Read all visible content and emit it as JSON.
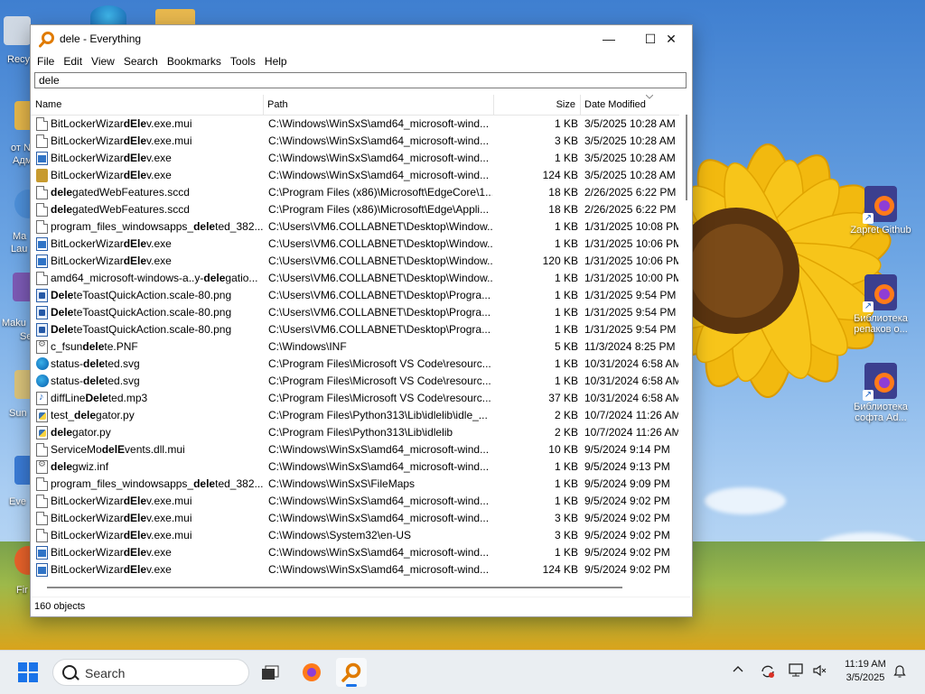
{
  "window": {
    "title": "dele - Everything",
    "minimize": "—",
    "maximize": "☐",
    "close": "✕"
  },
  "menu": [
    "File",
    "Edit",
    "View",
    "Search",
    "Bookmarks",
    "Tools",
    "Help"
  ],
  "search": {
    "value": "dele"
  },
  "columns": {
    "name": "Name",
    "path": "Path",
    "size": "Size",
    "date": "Date Modified"
  },
  "rows": [
    {
      "icon": "doc",
      "name": "BitLockerWizardElev.exe.mui",
      "path": "C:\\Windows\\WinSxS\\amd64_microsoft-wind...",
      "size": "1 KB",
      "date": "3/5/2025 10:28 AM"
    },
    {
      "icon": "doc",
      "name": "BitLockerWizardElev.exe.mui",
      "path": "C:\\Windows\\WinSxS\\amd64_microsoft-wind...",
      "size": "3 KB",
      "date": "3/5/2025 10:28 AM"
    },
    {
      "icon": "exe",
      "name": "BitLockerWizardElev.exe",
      "path": "C:\\Windows\\WinSxS\\amd64_microsoft-wind...",
      "size": "1 KB",
      "date": "3/5/2025 10:28 AM"
    },
    {
      "icon": "setup",
      "name": "BitLockerWizardElev.exe",
      "path": "C:\\Windows\\WinSxS\\amd64_microsoft-wind...",
      "size": "124 KB",
      "date": "3/5/2025 10:28 AM"
    },
    {
      "icon": "doc",
      "name": "delegatedWebFeatures.sccd",
      "path": "C:\\Program Files (x86)\\Microsoft\\EdgeCore\\1...",
      "size": "18 KB",
      "date": "2/26/2025 6:22 PM"
    },
    {
      "icon": "doc",
      "name": "delegatedWebFeatures.sccd",
      "path": "C:\\Program Files (x86)\\Microsoft\\Edge\\Appli...",
      "size": "18 KB",
      "date": "2/26/2025 6:22 PM"
    },
    {
      "icon": "doc",
      "name": "program_files_windowsapps_deleted_382...",
      "path": "C:\\Users\\VM6.COLLABNET\\Desktop\\Window...",
      "size": "1 KB",
      "date": "1/31/2025 10:08 PM"
    },
    {
      "icon": "exe",
      "name": "BitLockerWizardElev.exe",
      "path": "C:\\Users\\VM6.COLLABNET\\Desktop\\Window...",
      "size": "1 KB",
      "date": "1/31/2025 10:06 PM"
    },
    {
      "icon": "exe",
      "name": "BitLockerWizardElev.exe",
      "path": "C:\\Users\\VM6.COLLABNET\\Desktop\\Window...",
      "size": "120 KB",
      "date": "1/31/2025 10:06 PM"
    },
    {
      "icon": "doc",
      "name": "amd64_microsoft-windows-a..y-delegatio...",
      "path": "C:\\Users\\VM6.COLLABNET\\Desktop\\Window...",
      "size": "1 KB",
      "date": "1/31/2025 10:00 PM"
    },
    {
      "icon": "png",
      "name": "DeleteToastQuickAction.scale-80.png",
      "path": "C:\\Users\\VM6.COLLABNET\\Desktop\\Progra...",
      "size": "1 KB",
      "date": "1/31/2025 9:54 PM"
    },
    {
      "icon": "png",
      "name": "DeleteToastQuickAction.scale-80.png",
      "path": "C:\\Users\\VM6.COLLABNET\\Desktop\\Progra...",
      "size": "1 KB",
      "date": "1/31/2025 9:54 PM"
    },
    {
      "icon": "png",
      "name": "DeleteToastQuickAction.scale-80.png",
      "path": "C:\\Users\\VM6.COLLABNET\\Desktop\\Progra...",
      "size": "1 KB",
      "date": "1/31/2025 9:54 PM"
    },
    {
      "icon": "inf",
      "name": "c_fsundelete.PNF",
      "path": "C:\\Windows\\INF",
      "size": "5 KB",
      "date": "11/3/2024 8:25 PM"
    },
    {
      "icon": "svg",
      "name": "status-deleted.svg",
      "path": "C:\\Program Files\\Microsoft VS Code\\resourc...",
      "size": "1 KB",
      "date": "10/31/2024 6:58 AM"
    },
    {
      "icon": "svg",
      "name": "status-deleted.svg",
      "path": "C:\\Program Files\\Microsoft VS Code\\resourc...",
      "size": "1 KB",
      "date": "10/31/2024 6:58 AM"
    },
    {
      "icon": "mp3",
      "name": "diffLineDeleted.mp3",
      "path": "C:\\Program Files\\Microsoft VS Code\\resourc...",
      "size": "37 KB",
      "date": "10/31/2024 6:58 AM"
    },
    {
      "icon": "py",
      "name": "test_delegator.py",
      "path": "C:\\Program Files\\Python313\\Lib\\idlelib\\idle_...",
      "size": "2 KB",
      "date": "10/7/2024 11:26 AM"
    },
    {
      "icon": "py",
      "name": "delegator.py",
      "path": "C:\\Program Files\\Python313\\Lib\\idlelib",
      "size": "2 KB",
      "date": "10/7/2024 11:26 AM"
    },
    {
      "icon": "doc",
      "name": "ServiceModelEvents.dll.mui",
      "path": "C:\\Windows\\WinSxS\\amd64_microsoft-wind...",
      "size": "10 KB",
      "date": "9/5/2024 9:14 PM"
    },
    {
      "icon": "inf",
      "name": "delegwiz.inf",
      "path": "C:\\Windows\\WinSxS\\amd64_microsoft-wind...",
      "size": "1 KB",
      "date": "9/5/2024 9:13 PM"
    },
    {
      "icon": "doc",
      "name": "program_files_windowsapps_deleted_382...",
      "path": "C:\\Windows\\WinSxS\\FileMaps",
      "size": "1 KB",
      "date": "9/5/2024 9:09 PM"
    },
    {
      "icon": "doc",
      "name": "BitLockerWizardElev.exe.mui",
      "path": "C:\\Windows\\WinSxS\\amd64_microsoft-wind...",
      "size": "1 KB",
      "date": "9/5/2024 9:02 PM"
    },
    {
      "icon": "doc",
      "name": "BitLockerWizardElev.exe.mui",
      "path": "C:\\Windows\\WinSxS\\amd64_microsoft-wind...",
      "size": "3 KB",
      "date": "9/5/2024 9:02 PM"
    },
    {
      "icon": "doc",
      "name": "BitLockerWizardElev.exe.mui",
      "path": "C:\\Windows\\System32\\en-US",
      "size": "3 KB",
      "date": "9/5/2024 9:02 PM"
    },
    {
      "icon": "exe",
      "name": "BitLockerWizardElev.exe",
      "path": "C:\\Windows\\WinSxS\\amd64_microsoft-wind...",
      "size": "1 KB",
      "date": "9/5/2024 9:02 PM"
    },
    {
      "icon": "exe",
      "name": "BitLockerWizardElev.exe",
      "path": "C:\\Windows\\WinSxS\\amd64_microsoft-wind...",
      "size": "124 KB",
      "date": "9/5/2024 9:02 PM"
    }
  ],
  "status": "160 objects",
  "desktop_icons": [
    {
      "label": "Zapret Github",
      "icon": "firefox-shortcut-icon"
    },
    {
      "label": "Библиотека репаков о...",
      "icon": "firefox-shortcut-icon"
    },
    {
      "label": "Библиотека софта Ad...",
      "icon": "firefox-shortcut-icon"
    }
  ],
  "desktop_left_labels": [
    "Recy",
    "от N",
    "Адм",
    "Ma",
    "Lau",
    "Maku",
    "Se",
    "Sun",
    "Eve",
    "Fir"
  ],
  "taskbar": {
    "search_placeholder": "Search",
    "time": "11:19 AM",
    "date": "3/5/2025"
  },
  "colors": {
    "accent": "#1a73e8",
    "highlight_query": "dele"
  }
}
